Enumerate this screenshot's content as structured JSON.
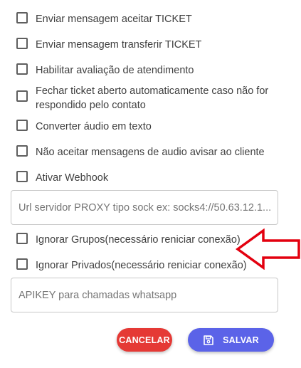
{
  "options": [
    {
      "label": "Enviar mensagem aceitar TICKET"
    },
    {
      "label": "Enviar mensagem transferir TICKET"
    },
    {
      "label": "Habilitar avaliação de atendimento"
    },
    {
      "label": "Fechar ticket aberto automaticamente caso não for respondido pelo contato"
    },
    {
      "label": "Converter áudio em texto"
    },
    {
      "label": "Não aceitar mensagens de audio avisar ao cliente"
    },
    {
      "label": "Ativar Webhook"
    },
    {
      "label": "Ignorar Grupos(necessário reniciar conexão)"
    },
    {
      "label": "Ignorar Privados(necessário reniciar conexão)"
    }
  ],
  "proxy_field": {
    "value": "",
    "placeholder": "Url servidor PROXY tipo sock ex: socks4://50.63.12.1..."
  },
  "apikey_field": {
    "value": "",
    "placeholder": "APIKEY para chamadas whatsapp"
  },
  "buttons": {
    "cancel_label": "CANCELAR",
    "save_label": "SALVAR",
    "save_icon": "save-icon"
  },
  "annotation": {
    "icon": "arrow-left-icon",
    "color": "#e3000f"
  },
  "colors": {
    "cancel": "#e53935",
    "save": "#5b63e8"
  }
}
